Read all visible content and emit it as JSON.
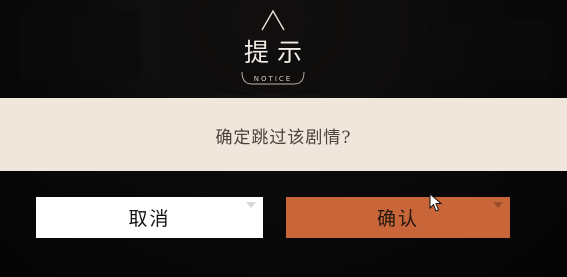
{
  "dialog": {
    "title": "提示",
    "subtitle": "NOTICE",
    "message": "确定跳过该剧情?"
  },
  "buttons": {
    "cancel_label": "取消",
    "confirm_label": "确认"
  },
  "icons": {
    "header": "peak-icon",
    "cursor": "mouse-cursor-icon"
  },
  "colors": {
    "background": "#050505",
    "band": "#f1e6dc",
    "cancel_bg": "#ffffff",
    "confirm_bg": "#c8663a",
    "message_text": "#4a423c"
  }
}
